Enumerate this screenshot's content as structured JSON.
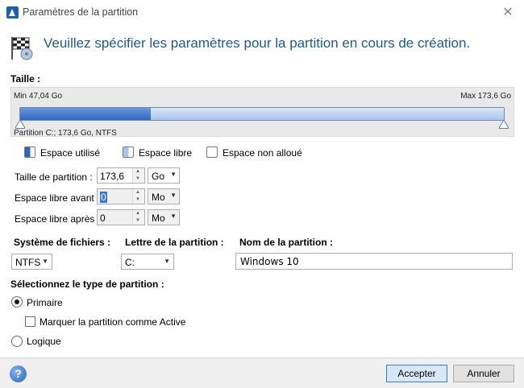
{
  "window": {
    "title": "Paramètres de la partition",
    "close_glyph": "✕"
  },
  "header": {
    "text": "Veuillez spécifier les paramètres pour la partition en cours de création.",
    "icon": "partition-flag-icon"
  },
  "size": {
    "label": "Taille :",
    "min_label": "Min 47,04 Go",
    "max_label": "Max 173,6 Go",
    "partition_caption": "Partition C:; 173,6 Go, NTFS",
    "used_fraction": 0.27
  },
  "legend": {
    "used": "Espace utilisé",
    "free": "Espace libre",
    "unallocated": "Espace non alloué"
  },
  "fields": {
    "partition_size": {
      "label": "Taille de partition :",
      "value": "173,6",
      "unit": "Go"
    },
    "free_before": {
      "label": "Espace libre avant :",
      "value": "0",
      "unit": "Mo"
    },
    "free_after": {
      "label": "Espace libre après :",
      "value": "0",
      "unit": "Mo"
    }
  },
  "filesystem": {
    "label": "Système de fichiers :",
    "value": "NTFS"
  },
  "drive_letter": {
    "label": "Lettre de la partition :",
    "value": "C:"
  },
  "partition_name": {
    "label": "Nom de la partition :",
    "value": "Windows 10"
  },
  "partition_type": {
    "label": "Sélectionnez le type de partition :",
    "primary": "Primaire",
    "mark_active": "Marquer la partition comme Active",
    "logical": "Logique"
  },
  "footer": {
    "help_glyph": "?",
    "accept": "Accepter",
    "cancel": "Annuler"
  },
  "colors": {
    "accent": "#1e5a96",
    "used_bar": "#2f66c0",
    "free_bar": "#a9c4ee"
  }
}
